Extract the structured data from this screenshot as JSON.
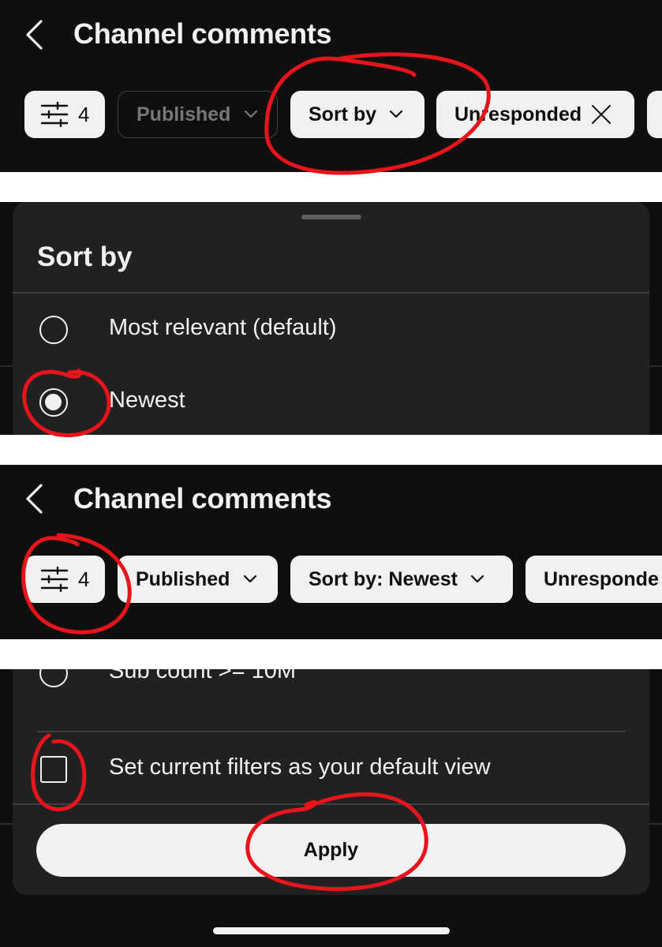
{
  "header_top": {
    "title": "Channel comments",
    "filter_count": "4",
    "chips": [
      "Published",
      "Sort by",
      "Unresponded"
    ]
  },
  "sort_sheet": {
    "title": "Sort by",
    "options": [
      {
        "label": "Most relevant (default)",
        "selected": false
      },
      {
        "label": "Newest",
        "selected": true
      }
    ]
  },
  "header_bottom": {
    "title": "Channel comments",
    "filter_count": "4",
    "chips": [
      "Published",
      "Sort by: Newest",
      "Unresponde"
    ]
  },
  "filter_sheet": {
    "partial_option": "Sub count >= 10M",
    "default_view_label": "Set current filters as your default view",
    "apply_label": "Apply"
  },
  "colors": {
    "background": "#0f0f0f",
    "sheet": "#212121",
    "chip": "#f1f1f1",
    "annotation": "#e8141b"
  },
  "icons": [
    "back-chevron-icon",
    "filter-sliders-icon",
    "chevron-down-icon",
    "close-x-icon"
  ]
}
